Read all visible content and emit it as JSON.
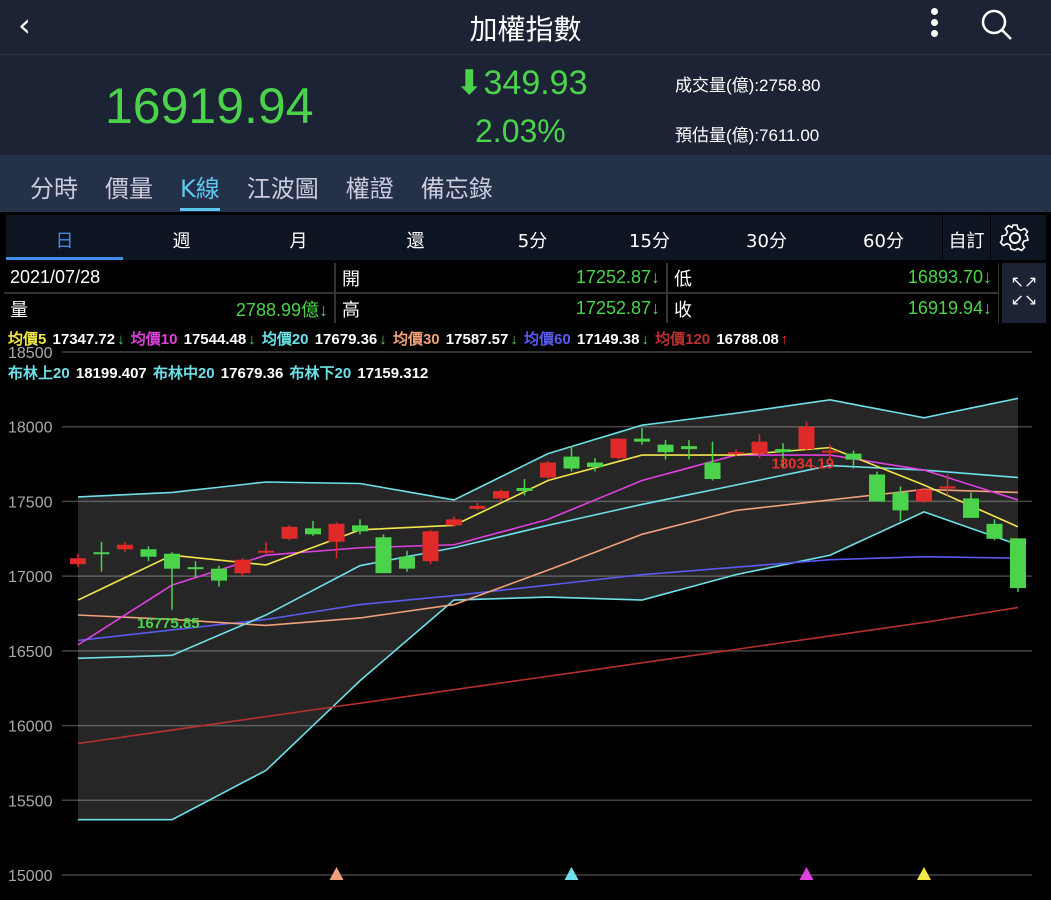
{
  "header": {
    "title": "加權指數",
    "back": "‹"
  },
  "quote": {
    "price": "16919.94",
    "change": "349.93",
    "change_arrow": "⬇",
    "percent": "2.03%",
    "volume": "成交量(億):2758.80",
    "est_volume": "預估量(億):7611.00"
  },
  "tabs": [
    {
      "label": "分時"
    },
    {
      "label": "價量"
    },
    {
      "label": "K線",
      "active": true
    },
    {
      "label": "江波圖"
    },
    {
      "label": "權證"
    },
    {
      "label": "備忘錄"
    }
  ],
  "periods": [
    {
      "label": "日",
      "active": true
    },
    {
      "label": "週"
    },
    {
      "label": "月"
    },
    {
      "label": "還"
    },
    {
      "label": "5分"
    },
    {
      "label": "15分"
    },
    {
      "label": "30分"
    },
    {
      "label": "60分"
    }
  ],
  "custom_label": "自訂",
  "info": {
    "date": "2021/07/28",
    "volume_label": "量",
    "volume": "2788.99億↓",
    "open_label": "開",
    "open": "17252.87↓",
    "high_label": "高",
    "high": "17252.87↓",
    "low_label": "低",
    "low": "16893.70↓",
    "close_label": "收",
    "close": "16919.94↓"
  },
  "ma_legend": [
    {
      "label": "均價5",
      "value": "17347.72",
      "arrow": "↓",
      "color": "#f2e64a"
    },
    {
      "label": "均價10",
      "value": "17544.48",
      "arrow": "↓",
      "color": "#e040e0"
    },
    {
      "label": "均價20",
      "value": "17679.36",
      "arrow": "↓",
      "color": "#6ee0e8"
    },
    {
      "label": "均價30",
      "value": "17587.57",
      "arrow": "↓",
      "color": "#f0a07a"
    },
    {
      "label": "均價60",
      "value": "17149.38",
      "arrow": "↓",
      "color": "#5a5af0"
    },
    {
      "label": "均價120",
      "value": "16788.08",
      "arrow": "↑",
      "color": "#b83030"
    }
  ],
  "bb_legend": [
    {
      "label": "布林上20",
      "value": "18199.407"
    },
    {
      "label": "布林中20",
      "value": "17679.36"
    },
    {
      "label": "布林下20",
      "value": "17159.312"
    }
  ],
  "chart_data": {
    "type": "candlestick",
    "ylim": [
      15000,
      18500
    ],
    "yticks": [
      18500,
      18000,
      17500,
      17000,
      16500,
      16000,
      15500,
      15000
    ],
    "candles": [
      [
        17080,
        17150,
        17060,
        17120
      ],
      [
        17160,
        17230,
        17030,
        17150
      ],
      [
        17180,
        17230,
        17160,
        17210
      ],
      [
        17180,
        17200,
        17100,
        17130
      ],
      [
        17150,
        17160,
        16775,
        17050
      ],
      [
        17060,
        17100,
        16990,
        17050
      ],
      [
        17050,
        17070,
        16930,
        16970
      ],
      [
        17020,
        17120,
        17000,
        17110
      ],
      [
        17160,
        17230,
        17150,
        17170
      ],
      [
        17250,
        17340,
        17240,
        17330
      ],
      [
        17320,
        17370,
        17270,
        17280
      ],
      [
        17230,
        17360,
        17120,
        17350
      ],
      [
        17340,
        17380,
        17280,
        17300
      ],
      [
        17260,
        17280,
        17020,
        17020
      ],
      [
        17130,
        17170,
        17030,
        17050
      ],
      [
        17100,
        17310,
        17080,
        17300
      ],
      [
        17340,
        17400,
        17330,
        17380
      ],
      [
        17450,
        17490,
        17440,
        17470
      ],
      [
        17520,
        17580,
        17500,
        17570
      ],
      [
        17590,
        17650,
        17540,
        17570
      ],
      [
        17660,
        17770,
        17650,
        17760
      ],
      [
        17800,
        17870,
        17700,
        17720
      ],
      [
        17760,
        17790,
        17700,
        17730
      ],
      [
        17790,
        17920,
        17780,
        17920
      ],
      [
        17920,
        17990,
        17880,
        17900
      ],
      [
        17880,
        17910,
        17780,
        17830
      ],
      [
        17870,
        17910,
        17780,
        17850
      ],
      [
        17760,
        17900,
        17640,
        17650
      ],
      [
        17830,
        17850,
        17800,
        17830
      ],
      [
        17820,
        17950,
        17790,
        17900
      ],
      [
        17850,
        17890,
        17720,
        17830
      ],
      [
        17850,
        18034,
        17840,
        18000
      ],
      [
        17840,
        17880,
        17780,
        17840
      ],
      [
        17820,
        17840,
        17720,
        17780
      ],
      [
        17680,
        17700,
        17500,
        17500
      ],
      [
        17560,
        17600,
        17370,
        17440
      ],
      [
        17500,
        17590,
        17490,
        17580
      ],
      [
        17600,
        17680,
        17540,
        17600
      ],
      [
        17520,
        17560,
        17390,
        17390
      ],
      [
        17350,
        17380,
        17240,
        17250
      ],
      [
        17252.87,
        17252.87,
        16893.7,
        16919.94
      ]
    ],
    "lines_sample_every": 4,
    "lines": [
      {
        "name": "布林上20",
        "color": "#6ee0e8",
        "values": [
          17530,
          17560,
          17630,
          17620,
          17510,
          17820,
          18010,
          18090,
          18180,
          18060,
          18190
        ]
      },
      {
        "name": "布林下20",
        "color": "#6ee0e8",
        "values": [
          15370,
          15370,
          15700,
          16300,
          16840,
          16860,
          16840,
          17010,
          17140,
          17430,
          17210
        ]
      },
      {
        "name": "MA120",
        "color": "#b83030",
        "values": [
          15880,
          15970,
          16060,
          16150,
          16240,
          16330,
          16420,
          16510,
          16600,
          16690,
          16790
        ]
      },
      {
        "name": "MA60",
        "color": "#5a5af0",
        "values": [
          16570,
          16640,
          16710,
          16810,
          16870,
          16940,
          17010,
          17060,
          17110,
          17130,
          17120
        ]
      },
      {
        "name": "MA30",
        "color": "#f0a07a",
        "values": [
          16740,
          16710,
          16670,
          16720,
          16810,
          17040,
          17280,
          17440,
          17510,
          17580,
          17560
        ]
      },
      {
        "name": "MA20",
        "color": "#6ee0e8",
        "values": [
          16450,
          16470,
          16740,
          17070,
          17190,
          17340,
          17480,
          17610,
          17740,
          17710,
          17660
        ]
      },
      {
        "name": "MA10",
        "color": "#e040e0",
        "values": [
          16540,
          16940,
          17140,
          17190,
          17210,
          17380,
          17640,
          17810,
          17810,
          17710,
          17510
        ]
      },
      {
        "name": "MA5",
        "color": "#f2e64a",
        "values": [
          16840,
          17140,
          17075,
          17310,
          17340,
          17640,
          17810,
          17810,
          17860,
          17610,
          17330
        ]
      }
    ],
    "annotations": [
      {
        "text": "18034.19",
        "candle": 31,
        "color": "#e53030"
      },
      {
        "text": "16775.85",
        "candle": 4,
        "color": "#4cd34c"
      }
    ],
    "markers": [
      {
        "candle": 11,
        "color": "#f0a07a"
      },
      {
        "candle": 21,
        "color": "#6ee0e8"
      },
      {
        "candle": 31,
        "color": "#e040e0"
      },
      {
        "candle": 36,
        "color": "#f2e64a"
      }
    ],
    "up_color": "#e02a2a",
    "down_color": "#4cd34c"
  }
}
